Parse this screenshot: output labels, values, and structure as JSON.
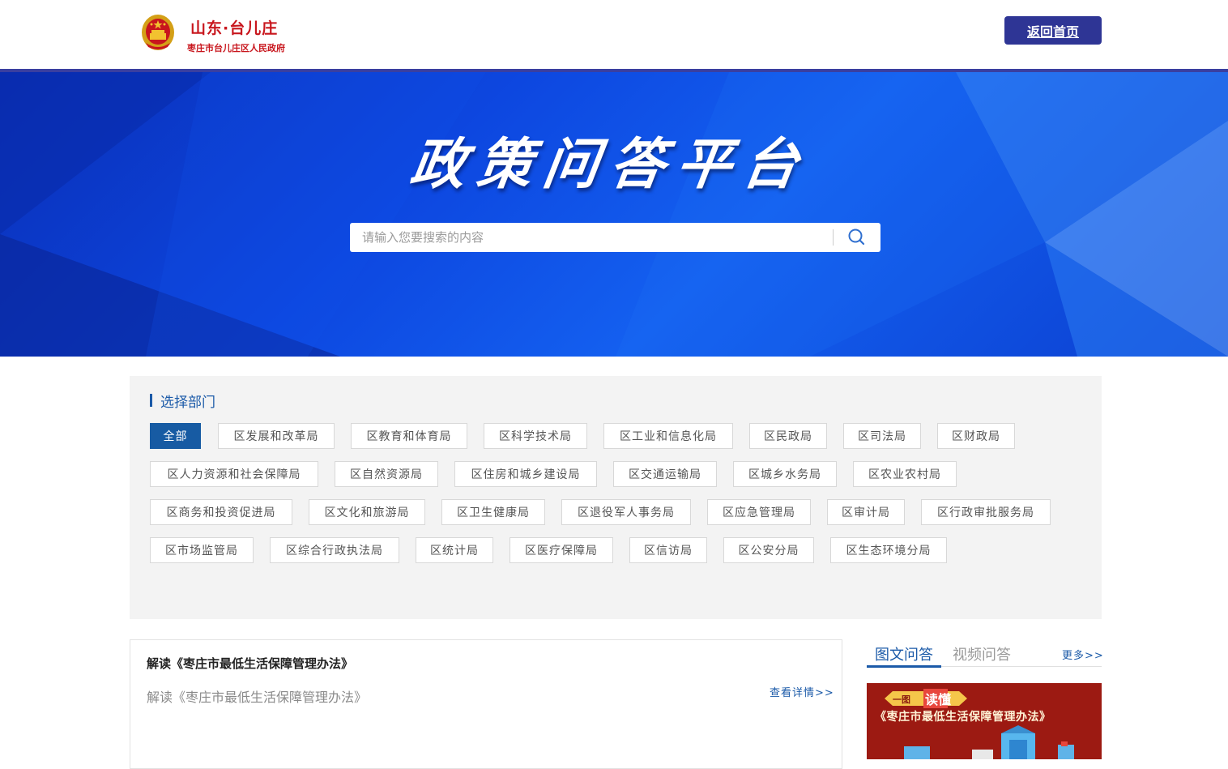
{
  "header": {
    "brand_title": "山东·台儿庄",
    "brand_subtitle": "枣庄市台儿庄区人民政府",
    "home_button": "返回首页"
  },
  "banner": {
    "title": "政策问答平台",
    "search_placeholder": "请输入您要搜索的内容"
  },
  "departments": {
    "heading": "选择部门",
    "tags": [
      {
        "label": "全部",
        "active": true
      },
      {
        "label": "区发展和改革局"
      },
      {
        "label": "区教育和体育局"
      },
      {
        "label": "区科学技术局"
      },
      {
        "label": "区工业和信息化局"
      },
      {
        "label": "区民政局"
      },
      {
        "label": "区司法局"
      },
      {
        "label": "区财政局"
      },
      {
        "label": "区人力资源和社会保障局"
      },
      {
        "label": "区自然资源局"
      },
      {
        "label": "区住房和城乡建设局"
      },
      {
        "label": "区交通运输局"
      },
      {
        "label": "区城乡水务局"
      },
      {
        "label": "区农业农村局"
      },
      {
        "label": "区商务和投资促进局"
      },
      {
        "label": "区文化和旅游局"
      },
      {
        "label": "区卫生健康局"
      },
      {
        "label": "区退役军人事务局"
      },
      {
        "label": "区应急管理局"
      },
      {
        "label": "区审计局"
      },
      {
        "label": "区行政审批服务局"
      },
      {
        "label": "区市场监管局"
      },
      {
        "label": "区综合行政执法局"
      },
      {
        "label": "区统计局"
      },
      {
        "label": "区医疗保障局"
      },
      {
        "label": "区信访局"
      },
      {
        "label": "区公安分局"
      },
      {
        "label": "区生态环境分局"
      }
    ]
  },
  "qa_item": {
    "title": "解读《枣庄市最低生活保障管理办法》",
    "summary": "解读《枣庄市最低生活保障管理办法》",
    "more": "查看详情>>"
  },
  "side": {
    "tab_1": "图文问答",
    "tab_2": "视频问答",
    "more": "更多>>",
    "thumb_badge_prefix": "一图",
    "thumb_badge_main": "读懂",
    "thumb_title": "《枣庄市最低生活保障管理办法》"
  },
  "colors": {
    "brand_red": "#c8161d",
    "nav_blue": "#2e3595",
    "accent_blue": "#1b5aa8",
    "active_tag": "#175ba3"
  }
}
